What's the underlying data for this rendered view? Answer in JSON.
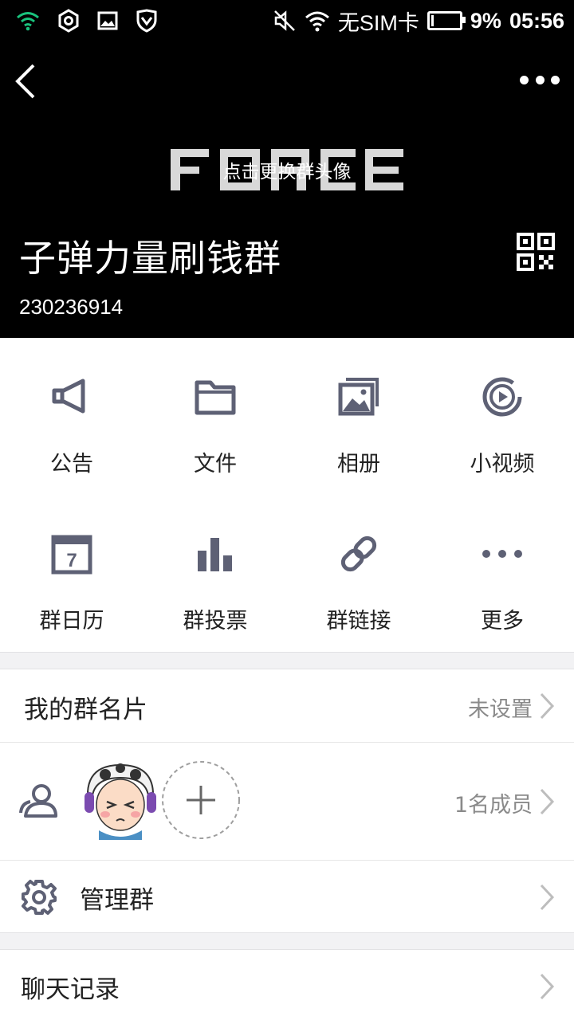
{
  "status_bar": {
    "carrier": "无SIM卡",
    "battery": "9%",
    "battery_level": 0.09,
    "time": "05:56",
    "left_icons": [
      "wifi-signal-icon",
      "settings-hex-icon",
      "gallery-icon",
      "shield-icon"
    ],
    "right_icons": [
      "mute-icon",
      "wifi-icon",
      "battery-icon"
    ]
  },
  "header": {
    "logo_text": "FORCE",
    "avatar_hint": "点击更换群头像",
    "group_name": "子弹力量刷钱群",
    "group_id": "230236914"
  },
  "features": [
    {
      "label": "公告",
      "icon": "announcement-icon"
    },
    {
      "label": "文件",
      "icon": "folder-icon"
    },
    {
      "label": "相册",
      "icon": "album-icon"
    },
    {
      "label": "小视频",
      "icon": "video-icon"
    },
    {
      "label": "群日历",
      "icon": "calendar-icon"
    },
    {
      "label": "群投票",
      "icon": "vote-icon"
    },
    {
      "label": "群链接",
      "icon": "link-icon"
    },
    {
      "label": "更多",
      "icon": "more-icon"
    }
  ],
  "calendar_day": "7",
  "card": {
    "title": "我的群名片",
    "value": "未设置"
  },
  "members": {
    "count_label": "1名成员"
  },
  "manage": {
    "title": "管理群"
  },
  "history": {
    "title": "聊天记录"
  },
  "colors": {
    "header_bg": "#000000",
    "icon_gray": "#5e6175",
    "divider": "#f2f2f4"
  }
}
